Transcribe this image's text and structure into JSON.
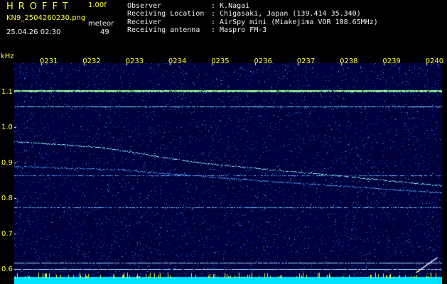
{
  "header": {
    "app_name": "HROFFT",
    "version": "1.00f",
    "filename": "KN9_2504260230.png",
    "plot_type": "meteor",
    "datetime": "25.04.26 02:30",
    "count": "49"
  },
  "meta": [
    {
      "label": "Observer",
      "value": ": K.Nagai"
    },
    {
      "label": "Receiving Location",
      "value": ": Chigasaki, Japan (139.414 35.340)"
    },
    {
      "label": "Receiver",
      "value": ": AirSpy mini (Miakejima VOR 108.65MHz)"
    },
    {
      "label": "Receiving antenna",
      "value": ": Maspro FM-3"
    }
  ],
  "axis": {
    "y_unit": "kHz",
    "y_ticks": [
      "1.1",
      "1.0",
      "0.9",
      "0.8",
      "0.7",
      "0.6"
    ],
    "x_ticks": [
      "0231",
      "0232",
      "0233",
      "0234",
      "0235",
      "0236",
      "0237",
      "0238",
      "0239",
      "0240"
    ]
  },
  "colors": {
    "text_yellow": "#ffff3a",
    "text_white": "#f0f0f0",
    "background": "#00003c",
    "noise": "#1a4ad8",
    "echo": "#8effff",
    "baseline": "#00e0ff"
  }
}
